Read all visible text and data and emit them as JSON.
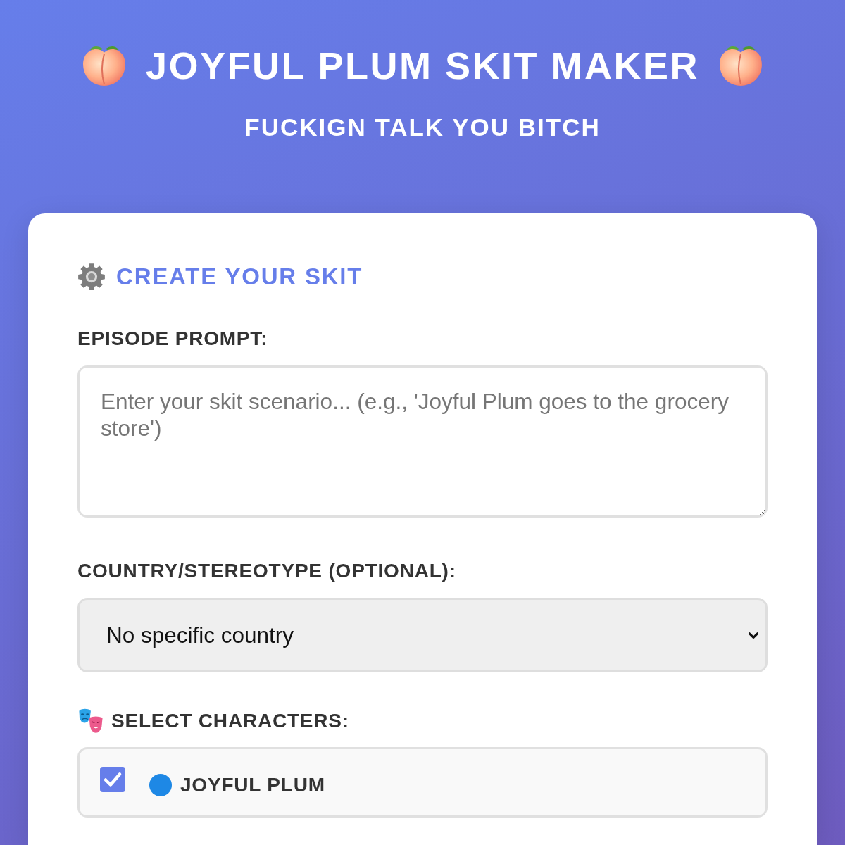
{
  "header": {
    "title": "JOYFUL PLUM SKIT MAKER",
    "subtitle": "FUCKIGN TALK YOU BITCH"
  },
  "form": {
    "heading": "CREATE YOUR SKIT",
    "prompt": {
      "label": "EPISODE PROMPT:",
      "placeholder": "Enter your skit scenario... (e.g., 'Joyful Plum goes to the grocery store')"
    },
    "country": {
      "label": "COUNTRY/STEREOTYPE (OPTIONAL):",
      "value": "No specific country"
    },
    "characters": {
      "label": "SELECT CHARACTERS:",
      "items": [
        {
          "name": "JOYFUL PLUM",
          "checked": true,
          "color": "#1e88e5"
        }
      ]
    }
  }
}
